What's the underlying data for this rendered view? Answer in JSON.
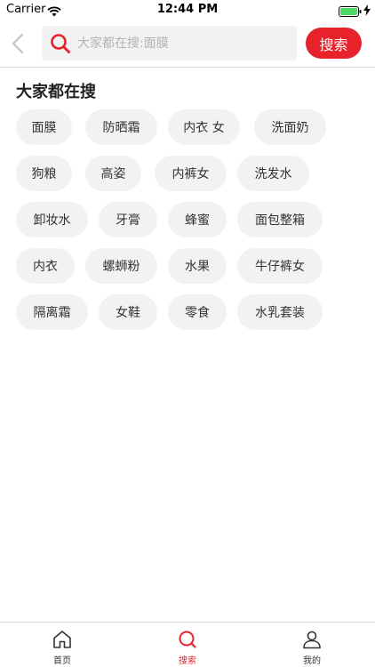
{
  "status_bar": {
    "carrier": "Carrier",
    "time": "12:44 PM"
  },
  "header": {
    "search_placeholder": "大家都在搜:面膜",
    "search_button": "搜索"
  },
  "hot_searches": {
    "title": "大家都在搜",
    "rows": [
      [
        "面膜",
        "防晒霜",
        "内衣 女",
        "洗面奶"
      ],
      [
        "狗粮",
        "高姿",
        "内裤女",
        "洗发水"
      ],
      [
        "卸妆水",
        "牙膏",
        "蜂蜜",
        "面包整箱"
      ],
      [
        "内衣",
        "螺蛳粉",
        "水果",
        "牛仔裤女"
      ],
      [
        "隔离霜",
        "女鞋",
        "零食",
        "水乳套装"
      ]
    ]
  },
  "tab_bar": {
    "items": [
      {
        "label": "首页",
        "icon": "home-icon"
      },
      {
        "label": "搜索",
        "icon": "search-icon"
      },
      {
        "label": "我的",
        "icon": "person-icon"
      }
    ],
    "active_index": 1
  },
  "colors": {
    "accent": "#e8222b",
    "tag_bg": "#f2f2f2",
    "text": "#222222"
  }
}
